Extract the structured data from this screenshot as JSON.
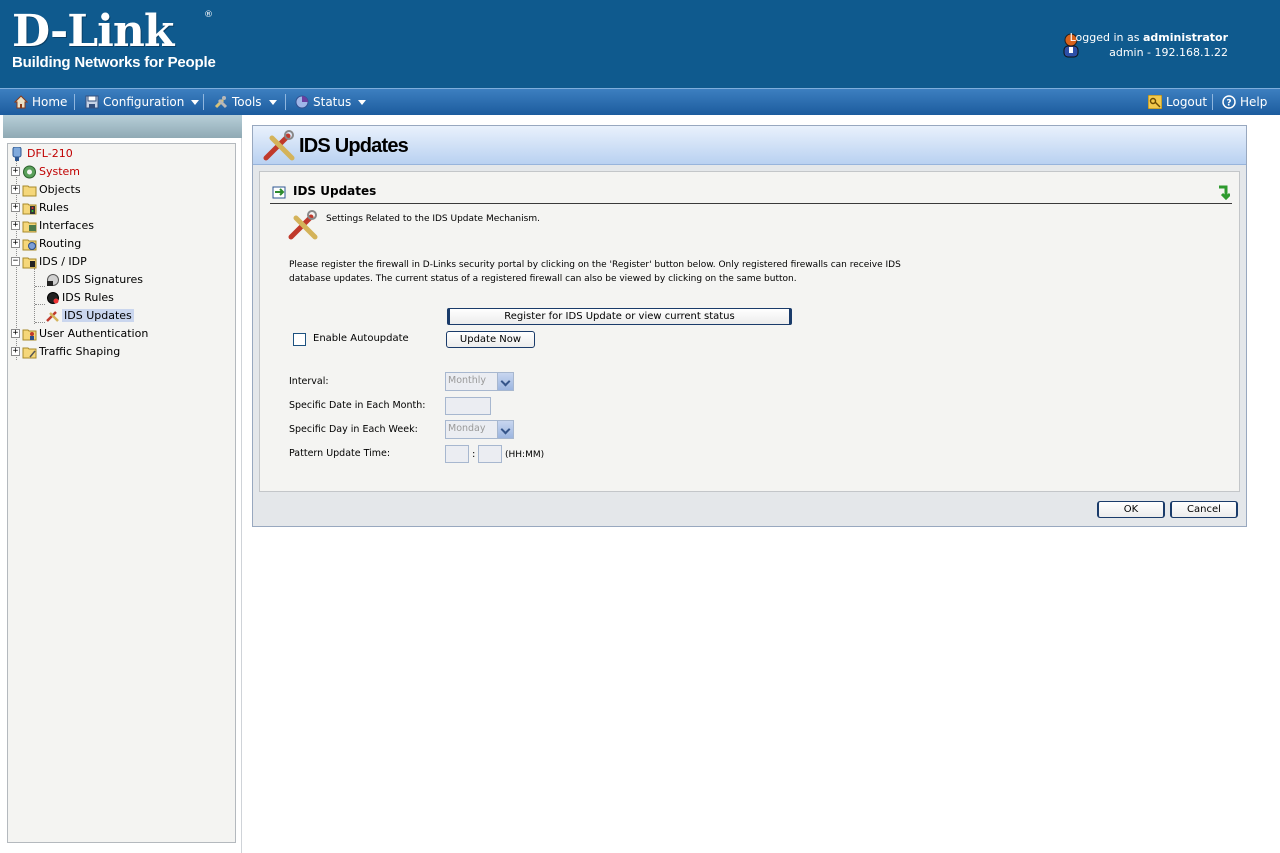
{
  "header": {
    "brand": "D-Link",
    "tagline": "Building Networks for People",
    "logged_in_prefix": "Logged in as ",
    "username": "administrator",
    "session": "admin - 192.168.1.22"
  },
  "menubar": {
    "home": "Home",
    "configuration": "Configuration",
    "tools": "Tools",
    "status": "Status",
    "logout": "Logout",
    "help": "Help"
  },
  "tree": {
    "root": "DFL-210",
    "items": [
      {
        "label": "System"
      },
      {
        "label": "Objects"
      },
      {
        "label": "Rules"
      },
      {
        "label": "Interfaces"
      },
      {
        "label": "Routing"
      },
      {
        "label": "IDS / IDP"
      },
      {
        "label": "IDS Signatures"
      },
      {
        "label": "IDS Rules"
      },
      {
        "label": "IDS Updates"
      },
      {
        "label": "User Authentication"
      },
      {
        "label": "Traffic Shaping"
      }
    ]
  },
  "main": {
    "title": "IDS Updates",
    "section_title": "IDS Updates",
    "description": "Settings Related to the IDS Update Mechanism.",
    "info": "Please register the firewall in D-Links security portal by clicking on the 'Register' button below. Only registered firewalls can receive IDS database updates. The current status of a registered firewall can also be viewed by clicking on the same button.",
    "register_button": "Register for IDS Update or view current status",
    "autoupdate_label": "Enable Autoupdate",
    "autoupdate_checked": false,
    "update_now_button": "Update Now",
    "interval_label": "Interval:",
    "interval_value": "Monthly",
    "date_label": "Specific Date in Each Month:",
    "day_label": "Specific Day in Each Week:",
    "day_value": "Monday",
    "time_label": "Pattern Update Time:",
    "time_separator": ":",
    "time_format": "(HH:MM)",
    "ok_button": "OK",
    "cancel_button": "Cancel"
  }
}
